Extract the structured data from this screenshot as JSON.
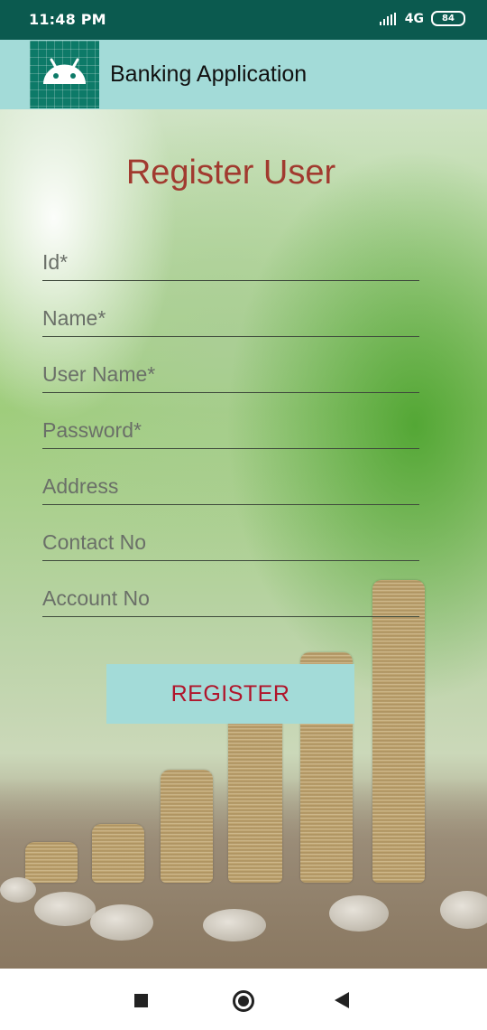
{
  "status_bar": {
    "time": "11:48 PM",
    "network": "4G",
    "battery": "84"
  },
  "app_bar": {
    "title": "Banking Application",
    "icon": "android-robot-icon"
  },
  "form": {
    "title": "Register User",
    "fields": [
      {
        "placeholder": "Id*",
        "value": ""
      },
      {
        "placeholder": "Name*",
        "value": ""
      },
      {
        "placeholder": "User Name*",
        "value": ""
      },
      {
        "placeholder": "Password*",
        "value": ""
      },
      {
        "placeholder": "Address",
        "value": ""
      },
      {
        "placeholder": "Contact No",
        "value": ""
      },
      {
        "placeholder": "Account No",
        "value": ""
      }
    ],
    "register_label": "REGISTER"
  },
  "colors": {
    "status_bar": "#0b5a4f",
    "app_bar": "#a3dbd8",
    "title_text": "#a13a2f",
    "button_text": "#b0152b"
  },
  "nav_bar": {
    "icons": [
      "recents-square-icon",
      "home-circle-icon",
      "back-triangle-icon"
    ]
  }
}
